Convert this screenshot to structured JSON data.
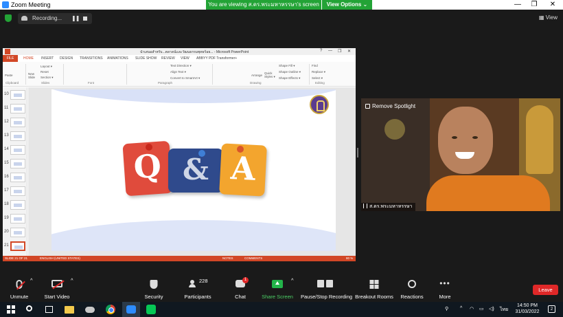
{
  "window": {
    "title": "Zoom Meeting",
    "viewing_banner": "You are viewing ส.ดร.พระมหาหรรษา's screen",
    "view_options": "View Options ⌄",
    "minimize": "—",
    "maximize": "❐",
    "close": "✕"
  },
  "recording": {
    "label": "Recording...",
    "pause_symbol": "❚❚"
  },
  "view_button": "▦ View",
  "powerpoint": {
    "title": "นำเสนอสำหรับ...ตลาดน์เเละวัฒนธรรมพุทธร้อย... - Microsoft PowerPoint",
    "tabs": [
      "FILE",
      "HOME",
      "INSERT",
      "DESIGN",
      "TRANSITIONS",
      "ANIMATIONS",
      "SLIDE SHOW",
      "REVIEW",
      "VIEW",
      "ABBYY PDF Transformer+"
    ],
    "active_tab": "HOME",
    "groups": [
      "Clipboard",
      "Slides",
      "Font",
      "Paragraph",
      "Drawing",
      "Editing"
    ],
    "commands": {
      "paste": "Paste",
      "new_slide": "New Slide",
      "layout": "Layout ▾",
      "reset": "Reset",
      "section": "Section ▾",
      "text_direction": "Text Direction ▾",
      "align_text": "Align Text ▾",
      "smartart": "Convert to SmartArt ▾",
      "arrange": "Arrange",
      "quick_styles": "Quick Styles ▾",
      "shape_fill": "Shape Fill ▾",
      "shape_outline": "Shape Outline ▾",
      "shape_effects": "Shape Effects ▾",
      "find": "Find",
      "replace": "Replace ▾",
      "select": "Select ▾"
    },
    "thumbnails": [
      "10",
      "11",
      "12",
      "13",
      "14",
      "15",
      "16",
      "17",
      "18",
      "19",
      "20",
      "21"
    ],
    "slide": {
      "q": "Q",
      "amp": "&",
      "a": "A"
    },
    "status": {
      "slide_count": "SLIDE 21 OF 21",
      "language": "ENGLISH (UNITED STATES)",
      "notes": "NOTES",
      "comments": "COMMENTS",
      "zoom": "80 %"
    }
  },
  "video": {
    "spotlight_label": "Remove Spotlight",
    "participant_name": "ส.ดร.พระมหาหรรษา"
  },
  "toolbar": {
    "unmute": "Unmute",
    "start_video": "Start Video",
    "security": "Security",
    "participants": "Participants",
    "participants_count": "228",
    "chat": "Chat",
    "chat_badge": "1",
    "share_screen": "Share Screen",
    "pause_recording": "Pause/Stop Recording",
    "breakout": "Breakout Rooms",
    "reactions": "Reactions",
    "more": "More",
    "leave": "Leave"
  },
  "taskbar": {
    "time": "14:50 PM",
    "date": "31/03/2022",
    "lang": "ไทย",
    "notifications": "2"
  },
  "colors": {
    "zoom_green": "#23a336",
    "ppt_orange": "#d24726",
    "leave_red": "#e02828",
    "bubble_red": "#e04b3c",
    "bubble_blue": "#2f4a8c",
    "bubble_orange": "#f3a52e"
  }
}
